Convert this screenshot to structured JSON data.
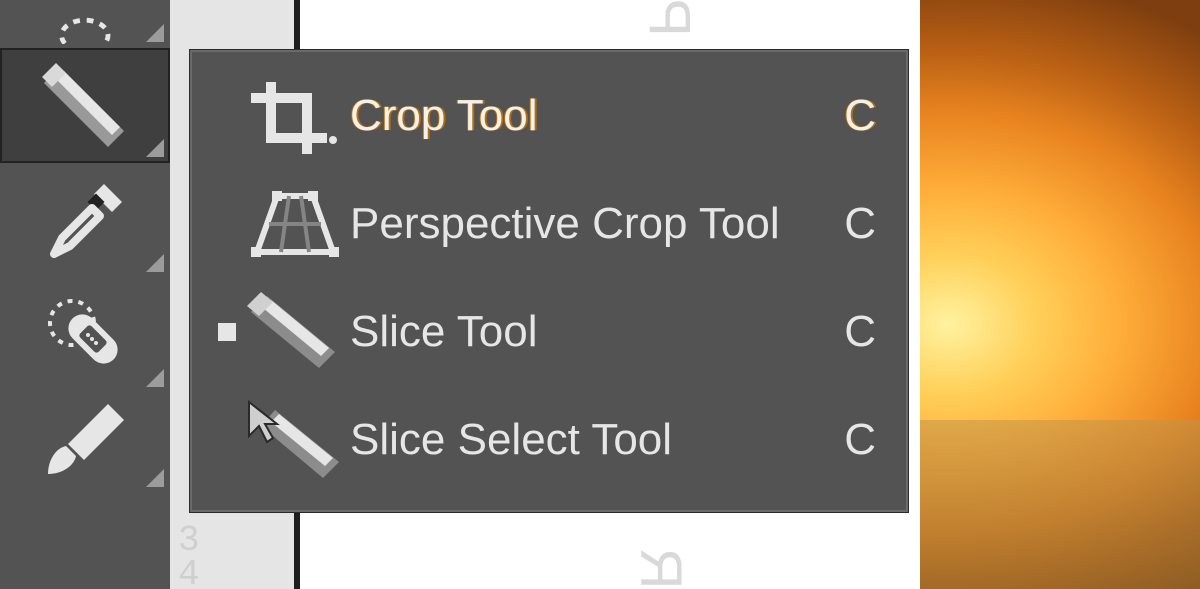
{
  "toolbar": {
    "tools": [
      {
        "name": "lasso-tool"
      },
      {
        "name": "crop-tool",
        "selected": true
      },
      {
        "name": "eyedropper-tool"
      },
      {
        "name": "spot-healing-brush-tool"
      },
      {
        "name": "brush-tool"
      }
    ]
  },
  "flyout": {
    "items": [
      {
        "icon": "crop-icon",
        "label": "Crop Tool",
        "shortcut": "C",
        "current": false
      },
      {
        "icon": "perspective-crop-icon",
        "label": "Perspective Crop Tool",
        "shortcut": "C",
        "current": false
      },
      {
        "icon": "slice-icon",
        "label": "Slice Tool",
        "shortcut": "C",
        "current": true
      },
      {
        "icon": "slice-select-icon",
        "label": "Slice Select Tool",
        "shortcut": "C",
        "current": false
      }
    ]
  },
  "ruler": {
    "n1": "3",
    "n2": "4"
  }
}
